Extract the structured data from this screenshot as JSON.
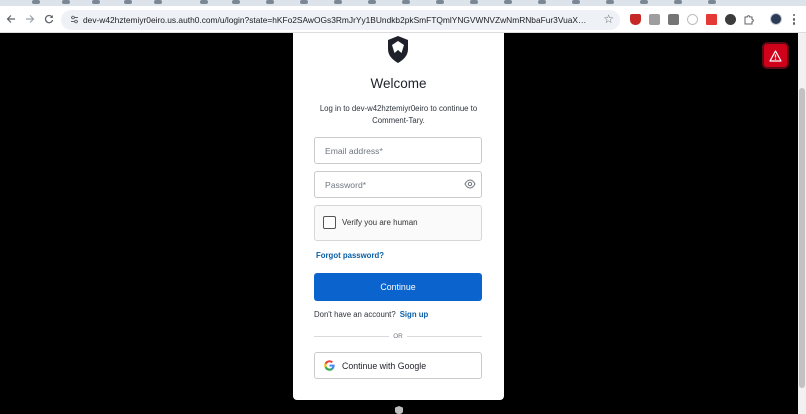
{
  "browser": {
    "url": "dev-w42hztemiyr0eiro.us.auth0.com/u/login?state=hKFo2SAwOGs3RmJrYy1BUndkb2pkSmFTQmlYNGVWNVZwNmRNbaFur3VuaXZlcnNhbC1sb2dpbqN0aWT...",
    "icons": [
      "back-icon",
      "forward-icon",
      "reload-icon",
      "site-info-icon",
      "bookmark-star-icon",
      "menu-icon"
    ]
  },
  "login": {
    "title": "Welcome",
    "subtitle": "Log in to dev-w42hztemiyr0eiro to continue to Comment-Tary.",
    "email_placeholder": "Email address*",
    "password_placeholder": "Password*",
    "captcha_label": "Verify you are human",
    "forgot_password": "Forgot password?",
    "continue_label": "Continue",
    "no_account_text": "Don't have an account?",
    "signup_link": "Sign up",
    "divider_text": "OR",
    "google_label": "Continue with Google"
  },
  "colors": {
    "primary": "#0b63ce",
    "link": "#0a5fa8",
    "warning": "#d0021b",
    "background": "#000000"
  }
}
